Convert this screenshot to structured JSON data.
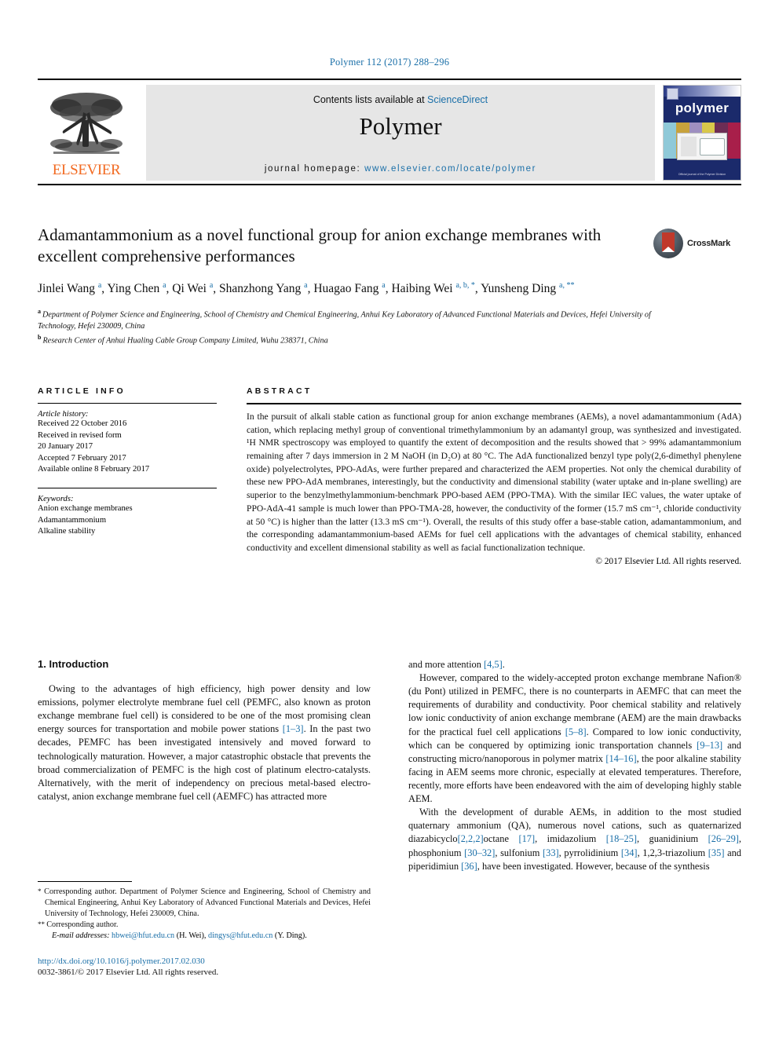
{
  "running_head": "Polymer 112 (2017) 288–296",
  "masthead": {
    "contents_prefix": "Contents lists available at ",
    "sciencedirect": "ScienceDirect",
    "journal_name": "Polymer",
    "homepage_label": "journal homepage: ",
    "homepage_url": "www.elsevier.com/locate/polymer",
    "publisher": "ELSEVIER",
    "cover": {
      "title": "polymer",
      "footer": "Official journal of the Polymer Division"
    }
  },
  "article": {
    "title": "Adamantammonium as a novel functional group for anion exchange membranes with excellent comprehensive performances",
    "crossmark_label": "CrossMark",
    "authors": [
      {
        "name": "Jinlei Wang",
        "marks": "a"
      },
      {
        "name": "Ying Chen",
        "marks": "a"
      },
      {
        "name": "Qi Wei",
        "marks": "a"
      },
      {
        "name": "Shanzhong Yang",
        "marks": "a"
      },
      {
        "name": "Huagao Fang",
        "marks": "a"
      },
      {
        "name": "Haibing Wei",
        "marks": "a, b, *"
      },
      {
        "name": "Yunsheng Ding",
        "marks": "a, **"
      }
    ],
    "affiliations": [
      {
        "mark": "a",
        "text": "Department of Polymer Science and Engineering, School of Chemistry and Chemical Engineering, Anhui Key Laboratory of Advanced Functional Materials and Devices, Hefei University of Technology, Hefei 230009, China"
      },
      {
        "mark": "b",
        "text": "Research Center of Anhui Hualing Cable Group Company Limited, Wuhu 238371, China"
      }
    ]
  },
  "article_info": {
    "heading": "ARTICLE INFO",
    "history_label": "Article history:",
    "history": [
      "Received 22 October 2016",
      "Received in revised form",
      "20 January 2017",
      "Accepted 7 February 2017",
      "Available online 8 February 2017"
    ],
    "keywords_label": "Keywords:",
    "keywords": [
      "Anion exchange membranes",
      "Adamantammonium",
      "Alkaline stability"
    ]
  },
  "abstract": {
    "heading": "ABSTRACT",
    "text": "In the pursuit of alkali stable cation as functional group for anion exchange membranes (AEMs), a novel adamantammonium (AdA) cation, which replacing methyl group of conventional trimethylammonium by an adamantyl group, was synthesized and investigated. ¹H NMR spectroscopy was employed to quantify the extent of decomposition and the results showed that > 99% adamantammonium remaining after 7 days immersion in 2 M NaOH (in D₂O) at 80 °C. The AdA functionalized benzyl type poly(2,6-dimethyl phenylene oxide) polyelectrolytes, PPO-AdAs, were further prepared and characterized the AEM properties. Not only the chemical durability of these new PPO-AdA membranes, interestingly, but the conductivity and dimensional stability (water uptake and in-plane swelling) are superior to the benzylmethylammonium-benchmark PPO-based AEM (PPO-TMA). With the similar IEC values, the water uptake of PPO-AdA-41 sample is much lower than PPO-TMA-28, however, the conductivity of the former (15.7 mS cm⁻¹, chloride conductivity at 50 °C) is higher than the latter (13.3 mS cm⁻¹). Overall, the results of this study offer a base-stable cation, adamantammonium, and the corresponding adamantammonium-based AEMs for fuel cell applications with the advantages of chemical stability, enhanced conductivity and excellent dimensional stability as well as facial functionalization technique.",
    "copyright": "© 2017 Elsevier Ltd. All rights reserved."
  },
  "introduction": {
    "heading": "1. Introduction",
    "left_paragraph": "Owing to the advantages of high efficiency, high power density and low emissions, polymer electrolyte membrane fuel cell (PEMFC, also known as proton exchange membrane fuel cell) is considered to be one of the most promising clean energy sources for transportation and mobile power stations [1–3]. In the past two decades, PEMFC has been investigated intensively and moved forward to technologically maturation. However, a major catastrophic obstacle that prevents the broad commercialization of PEMFC is the high cost of platinum electro-catalysts. Alternatively, with the merit of independency on precious metal-based electro-catalyst, anion exchange membrane fuel cell (AEMFC) has attracted more",
    "right_paragraph_continued": "and more attention [4,5].",
    "right_paragraph_2": "However, compared to the widely-accepted proton exchange membrane Nafion® (du Pont) utilized in PEMFC, there is no counterparts in AEMFC that can meet the requirements of durability and conductivity. Poor chemical stability and relatively low ionic conductivity of anion exchange membrane (AEM) are the main drawbacks for the practical fuel cell applications [5–8]. Compared to low ionic conductivity, which can be conquered by optimizing ionic transportation channels [9–13] and constructing micro/nanoporous in polymer matrix [14–16], the poor alkaline stability facing in AEM seems more chronic, especially at elevated temperatures. Therefore, recently, more efforts have been endeavored with the aim of developing highly stable AEM.",
    "right_paragraph_3": "With the development of durable AEMs, in addition to the most studied quaternary ammonium (QA), numerous novel cations, such as quaternarized diazabicyclo[2,2,2]octane [17], imidazolium [18–25], guanidinium [26–29], phosphonium [30–32], sulfonium [33], pyrrolidinium [34], 1,2,3-triazolium [35] and piperidimiun [36], have been investigated. However, because of the synthesis"
  },
  "footnotes": {
    "corr1": "Corresponding author. Department of Polymer Science and Engineering, School of Chemistry and Chemical Engineering, Anhui Key Laboratory of Advanced Functional Materials and Devices, Hefei University of Technology, Hefei 230009, China.",
    "corr2": "Corresponding author.",
    "email_label": "E-mail addresses:",
    "email1": "hbwei@hfut.edu.cn",
    "email1_owner": "(H. Wei),",
    "email2": "dingys@hfut.edu.cn",
    "email2_owner": "(Y. Ding).",
    "doi": "http://dx.doi.org/10.1016/j.polymer.2017.02.030",
    "issn": "0032-3861/© 2017 Elsevier Ltd. All rights reserved."
  },
  "colors": {
    "link": "#1a6fa8",
    "elsevier_orange": "#F26A21",
    "cover_blue": "#1b2a6b"
  }
}
